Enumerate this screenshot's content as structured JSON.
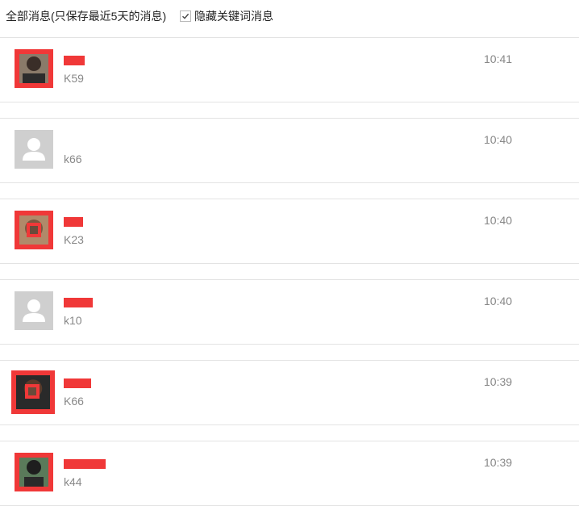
{
  "header": {
    "filter_label": "全部消息(只保存最近5天的消息)",
    "hide_keyword_label": "隐藏关键词消息",
    "hide_keyword_checked": true
  },
  "messages": [
    {
      "code": "K59",
      "time": "10:41",
      "avatar": "photo"
    },
    {
      "code": "k66",
      "time": "10:40",
      "avatar": "default"
    },
    {
      "code": "K23",
      "time": "10:40",
      "avatar": "photo"
    },
    {
      "code": "k10",
      "time": "10:40",
      "avatar": "default"
    },
    {
      "code": "K66",
      "time": "10:39",
      "avatar": "photo"
    },
    {
      "code": "k44",
      "time": "10:39",
      "avatar": "photo"
    }
  ],
  "colors": {
    "redaction": "#f03838",
    "divider": "#e3e3e3",
    "muted_text": "#888888",
    "default_avatar_bg": "#cfcfcf"
  }
}
